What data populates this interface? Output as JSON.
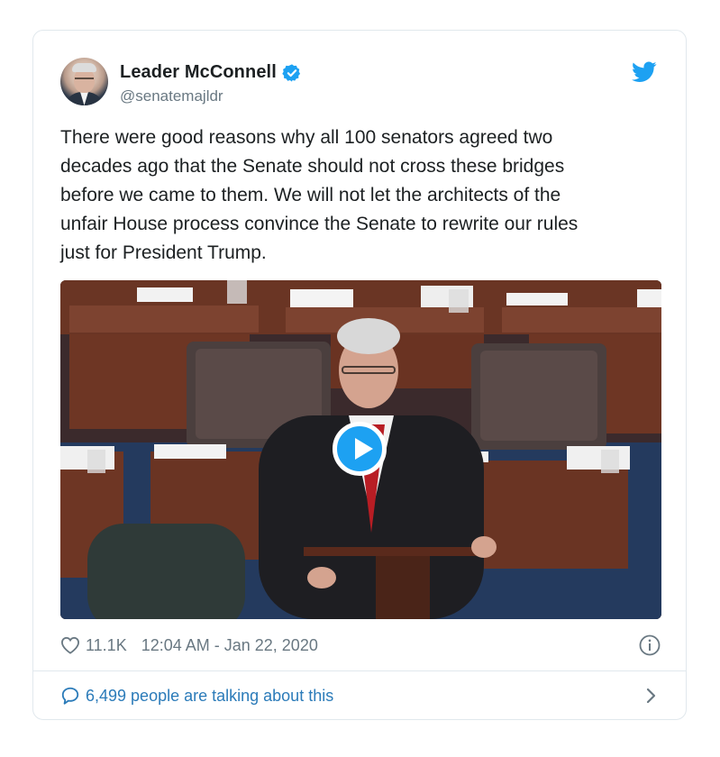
{
  "tweet": {
    "author": {
      "name": "Leader McConnell",
      "handle": "@senatemajldr",
      "verified": true,
      "avatar_icon": "avatar"
    },
    "text": "There were good reasons why all 100 senators agreed two decades ago that the Senate should not cross these bridges before we came to them. We will not let the architects of the unfair House process convince the Senate to rewrite our rules just for President Trump.",
    "text_lines": [
      "There were good reasons why all 100 senators agreed two",
      "decades ago that the Senate should not cross these bridges",
      "before we came to them. We will not let the architects of the",
      "unfair House process convince the Senate to rewrite our rules",
      "just for President Trump."
    ],
    "media": {
      "type": "video",
      "play_icon": "play-icon"
    },
    "likes": "11.1K",
    "timestamp": "12:04 AM - Jan 22, 2020",
    "conversation": "6,499 people are talking about this"
  },
  "colors": {
    "brand": "#1da1f2",
    "link": "#2b7bb9",
    "text": "#1c2022",
    "muted": "#697882",
    "border": "#e1e8ed"
  },
  "icons": {
    "verified": "verified-badge-icon",
    "twitter": "twitter-bird-icon",
    "like": "heart-icon",
    "info": "info-icon",
    "reply": "speech-bubble-icon",
    "more": "chevron-right-icon"
  }
}
